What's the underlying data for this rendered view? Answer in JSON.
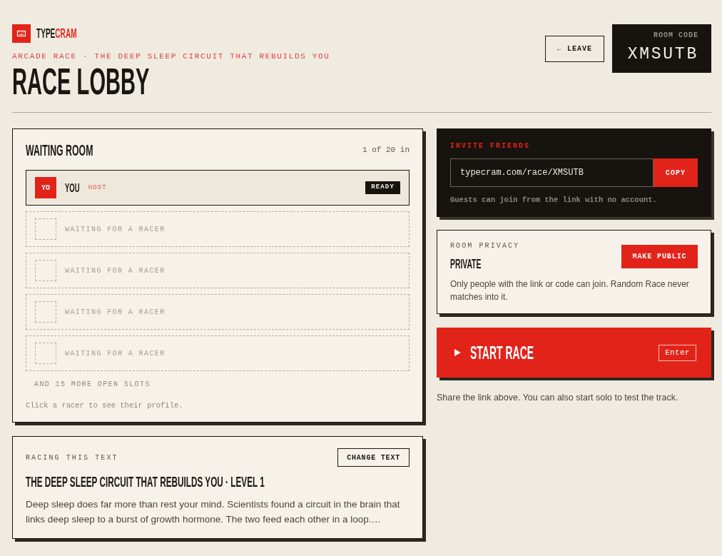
{
  "brand": {
    "parts": [
      {
        "text": "TYPE",
        "color": "#1a1612"
      },
      {
        "text": "CRAM",
        "color": "#e2231a"
      }
    ]
  },
  "header": {
    "eyebrow": "ARCADE RACE · THE DEEP SLEEP CIRCUIT THAT REBUILDS YOU",
    "title": "RACE LOBBY",
    "leave_button": "← LEAVE",
    "room_code": {
      "label": "ROOM CODE",
      "code": "XMSUTB"
    }
  },
  "waiting_room": {
    "title": "WAITING ROOM",
    "count": "1 of 20 in",
    "slots": [
      {
        "kind": "racer",
        "avatar": "YO",
        "name": "YOU",
        "role": "HOST",
        "status": "READY"
      },
      {
        "kind": "empty",
        "label": "WAITING FOR A RACER"
      },
      {
        "kind": "empty",
        "label": "WAITING FOR A RACER"
      },
      {
        "kind": "empty",
        "label": "WAITING FOR A RACER"
      },
      {
        "kind": "empty",
        "label": "WAITING FOR A RACER"
      }
    ],
    "more": "AND 15 MORE OPEN SLOTS",
    "hint": "Click a racer to see their profile."
  },
  "race_text": {
    "label": "RACING THIS TEXT",
    "button": "CHANGE TEXT",
    "title": "THE DEEP SLEEP CIRCUIT THAT REBUILDS YOU · LEVEL 1",
    "excerpt": "Deep sleep does far more than rest your mind. Scientists found a circuit in the brain that links deep sleep to a burst of growth hormone. The two feed each other in a loop.…"
  },
  "invite": {
    "label": "INVITE FRIENDS",
    "link": "typecram.com/race/XMSUTB",
    "button": "COPY",
    "note": "Guests can join from the link with no account."
  },
  "privacy": {
    "label": "ROOM PRIVACY",
    "value": "PRIVATE",
    "button": "MAKE PUBLIC",
    "description": "Only people with the link or code can join. Random Race never matches into it."
  },
  "start": {
    "button": "START RACE",
    "shortcut": "Enter",
    "note": "Share the link above. You can also start solo to test the track."
  }
}
